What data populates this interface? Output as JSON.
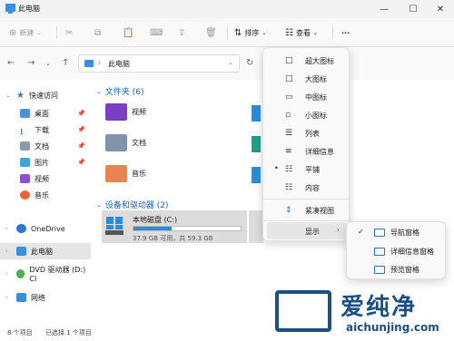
{
  "window": {
    "title": "此电脑",
    "minimize": "—",
    "maximize": "☐",
    "close": "✕"
  },
  "toolbar": {
    "new_label": "新建",
    "sort_label": "排序",
    "view_label": "查看",
    "more_label": "···"
  },
  "address": {
    "crumb": "此电脑"
  },
  "sidebar": {
    "items": [
      {
        "label": "快速访问",
        "icon": "star-icon"
      },
      {
        "label": "桌面",
        "icon": "desktop-icon"
      },
      {
        "label": "下载",
        "icon": "download-icon"
      },
      {
        "label": "文档",
        "icon": "document-icon"
      },
      {
        "label": "图片",
        "icon": "pictures-icon"
      },
      {
        "label": "视频",
        "icon": "videos-icon"
      },
      {
        "label": "音乐",
        "icon": "music-icon"
      },
      {
        "label": "OneDrive",
        "icon": "cloud-icon"
      },
      {
        "label": "此电脑",
        "icon": "computer-icon"
      },
      {
        "label": "DVD 驱动器 (D:) CI",
        "icon": "dvd-icon"
      },
      {
        "label": "网络",
        "icon": "network-icon"
      }
    ]
  },
  "content": {
    "folders_header": "文件夹 (6)",
    "folders": [
      {
        "label": "视频",
        "icon": "videos-folder-icon"
      },
      {
        "label": "文档",
        "icon": "documents-folder-icon"
      },
      {
        "label": "音乐",
        "icon": "music-folder-icon"
      }
    ],
    "devices_header": "设备和驱动器 (2)",
    "drive": {
      "name": "本地磁盘 (C:)",
      "size": "37.9 GB 可用，共 59.3 GB",
      "used_fraction": 0.36
    }
  },
  "view_menu": {
    "items": [
      {
        "label": "超大图标",
        "icon": "□"
      },
      {
        "label": "大图标",
        "icon": "□"
      },
      {
        "label": "中图标",
        "icon": "▭"
      },
      {
        "label": "小图标",
        "icon": "▫"
      },
      {
        "label": "列表",
        "icon": "☰"
      },
      {
        "label": "详细信息",
        "icon": "≡"
      },
      {
        "label": "平铺",
        "icon": "☷",
        "selected_mark": "•"
      },
      {
        "label": "内容",
        "icon": "☷"
      }
    ],
    "compact": {
      "label": "紧凑视图",
      "icon": "⇕"
    },
    "show": {
      "label": "显示",
      "arrow": "›"
    }
  },
  "show_submenu": {
    "items": [
      {
        "label": "导航窗格",
        "check": "✓"
      },
      {
        "label": "详细信息窗格",
        "check": ""
      },
      {
        "label": "预览窗格",
        "check": ""
      }
    ]
  },
  "status": {
    "count": "8 个项目",
    "selected": "已选择 1 个项目"
  },
  "watermark": {
    "brand": "爱纯净",
    "url": "aichunjing.com"
  }
}
